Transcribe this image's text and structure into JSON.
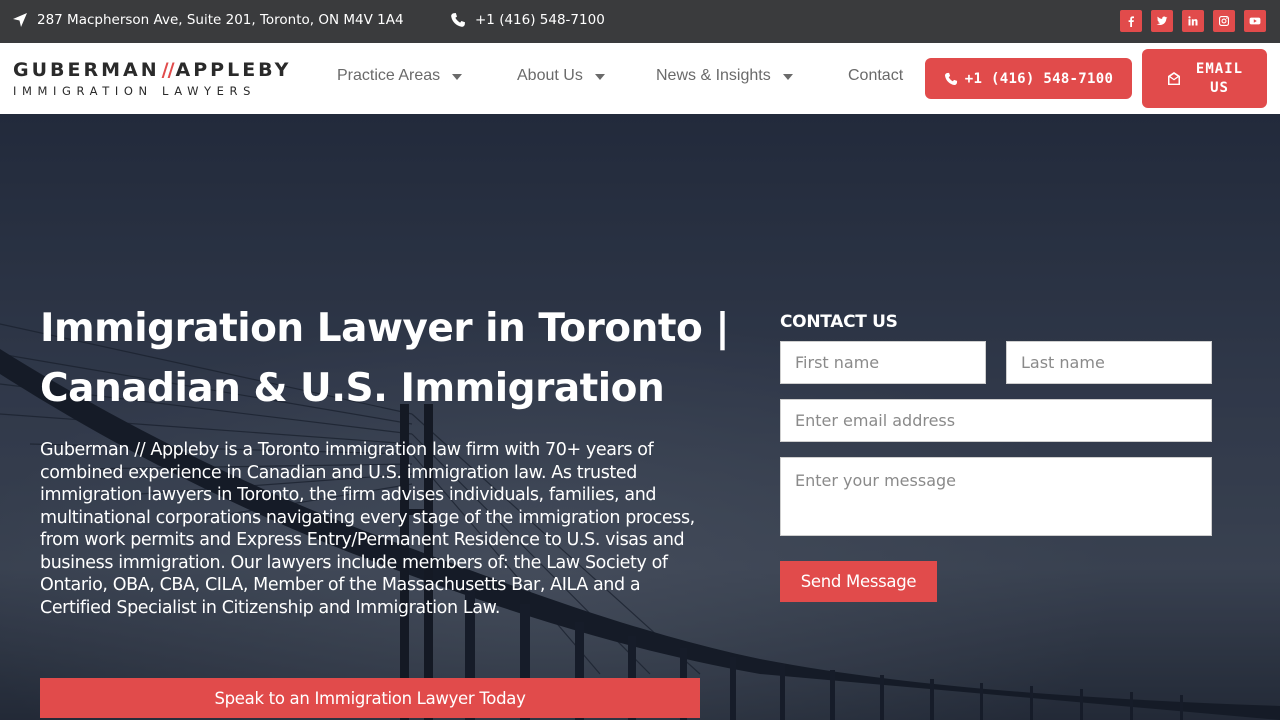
{
  "topbar": {
    "address": "287 Macpherson Ave, Suite 201, Toronto, ON M4V 1A4",
    "phone": "+1 (416) 548-7100",
    "socials": [
      "facebook-icon",
      "twitter-icon",
      "linkedin-icon",
      "instagram-icon",
      "youtube-icon"
    ]
  },
  "header": {
    "logo_main_left": "GUBERMAN",
    "logo_slashes": "//",
    "logo_main_right": "APPLEBY",
    "logo_sub": "IMMIGRATION LAWYERS",
    "nav": [
      {
        "label": "Practice Areas",
        "has_dropdown": true
      },
      {
        "label": "About Us",
        "has_dropdown": true
      },
      {
        "label": "News & Insights",
        "has_dropdown": true
      },
      {
        "label": "Contact",
        "has_dropdown": false
      }
    ],
    "phone_button": "+1 (416) 548-7100",
    "email_button": "EMAIL US",
    "accent_color": "#e14b4b"
  },
  "hero": {
    "title": "Immigration Lawyer in Toronto | Canadian & U.S. Immigration",
    "description": "Guberman // Appleby is a Toronto immigration law firm with 70+ years of combined experience in Canadian and U.S. immigration law. As  trusted immigration lawyers in Toronto, the firm advises individuals, families, and multinational corporations navigating every stage of the immigration process, from work permits and Express Entry/Permanent Residence to U.S. visas and business immigration. Our lawyers include members of: the  Law Society of Ontario, OBA, CBA, CILA, Member of the Massachusetts Bar,  AILA  and a Certified Specialist in Citizenship and Immigration Law.",
    "cta": "Speak to an Immigration Lawyer Today"
  },
  "contact_form": {
    "title": "CONTACT US",
    "first_name_placeholder": "First name",
    "last_name_placeholder": "Last name",
    "email_placeholder": "Enter email address",
    "message_placeholder": "Enter your message",
    "submit": "Send Message"
  }
}
